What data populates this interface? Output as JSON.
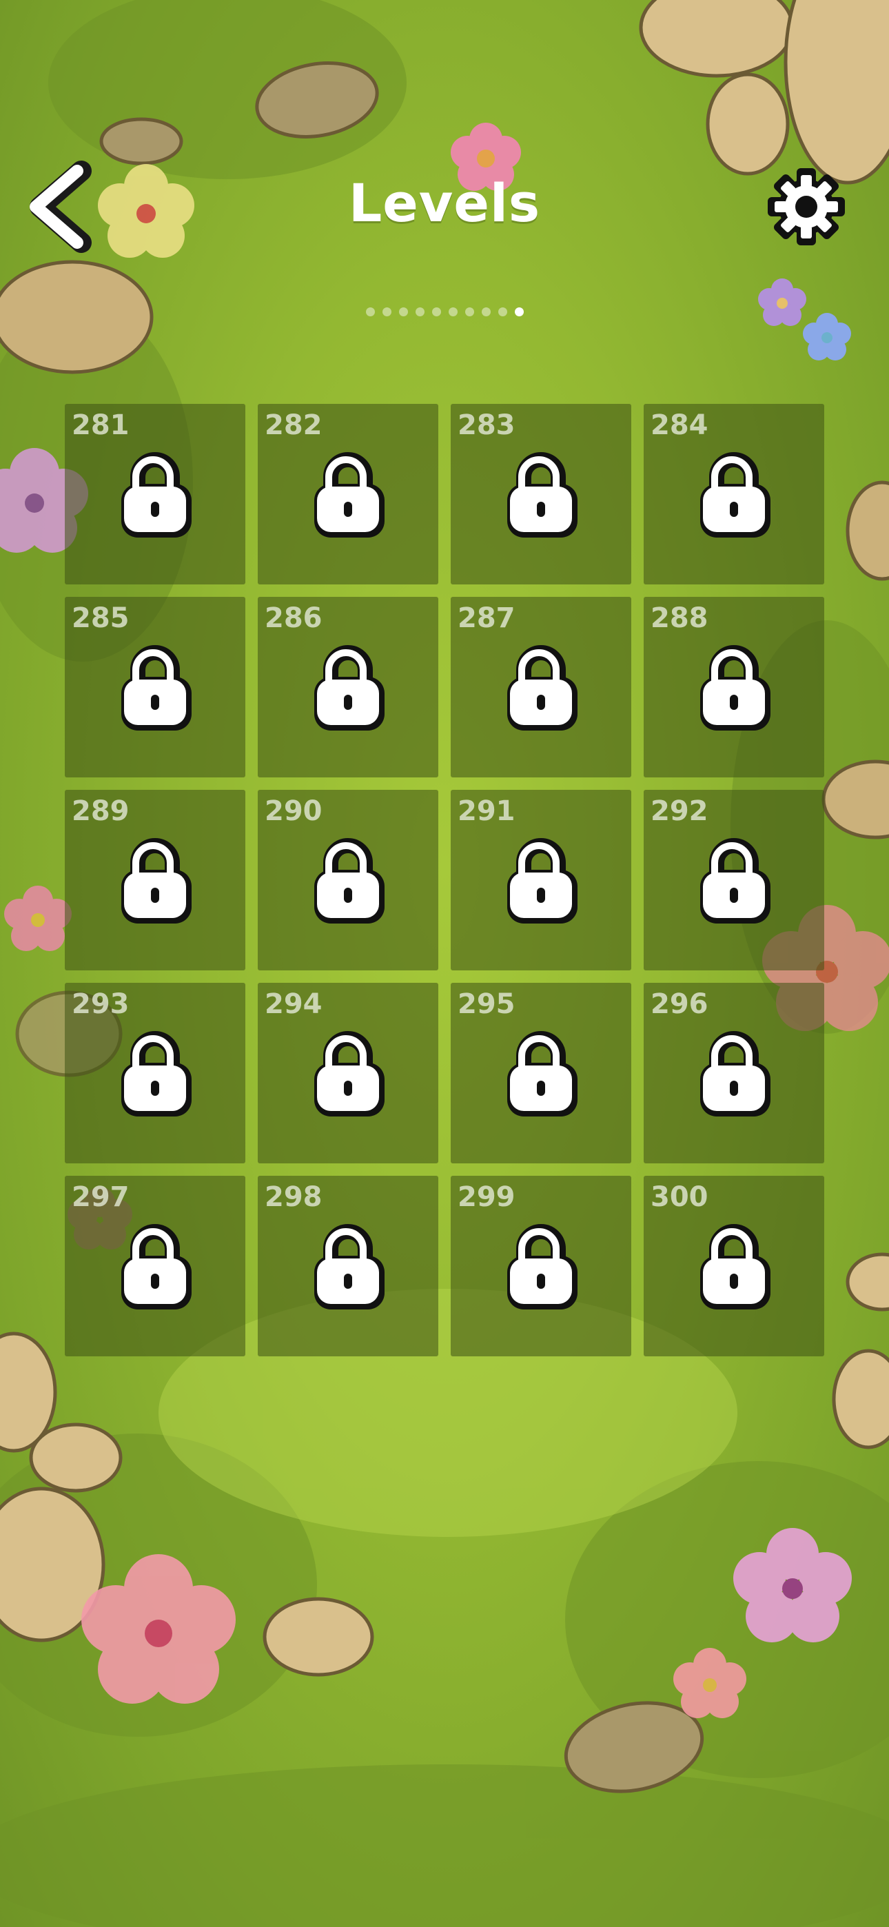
{
  "header": {
    "title": "Levels",
    "back_icon": "chevron-left-icon",
    "settings_icon": "gear-icon"
  },
  "pager": {
    "total_pages": 10,
    "active_page": 10
  },
  "levels": [
    {
      "number": "281",
      "locked": true
    },
    {
      "number": "282",
      "locked": true
    },
    {
      "number": "283",
      "locked": true
    },
    {
      "number": "284",
      "locked": true
    },
    {
      "number": "285",
      "locked": true
    },
    {
      "number": "286",
      "locked": true
    },
    {
      "number": "287",
      "locked": true
    },
    {
      "number": "288",
      "locked": true
    },
    {
      "number": "289",
      "locked": true
    },
    {
      "number": "290",
      "locked": true
    },
    {
      "number": "291",
      "locked": true
    },
    {
      "number": "292",
      "locked": true
    },
    {
      "number": "293",
      "locked": true
    },
    {
      "number": "294",
      "locked": true
    },
    {
      "number": "295",
      "locked": true
    },
    {
      "number": "296",
      "locked": true
    },
    {
      "number": "297",
      "locked": true
    },
    {
      "number": "298",
      "locked": true
    },
    {
      "number": "299",
      "locked": true
    },
    {
      "number": "300",
      "locked": true
    }
  ],
  "colors": {
    "grass": "#93b832",
    "tile": "#3e5214",
    "title": "#ffffff"
  }
}
